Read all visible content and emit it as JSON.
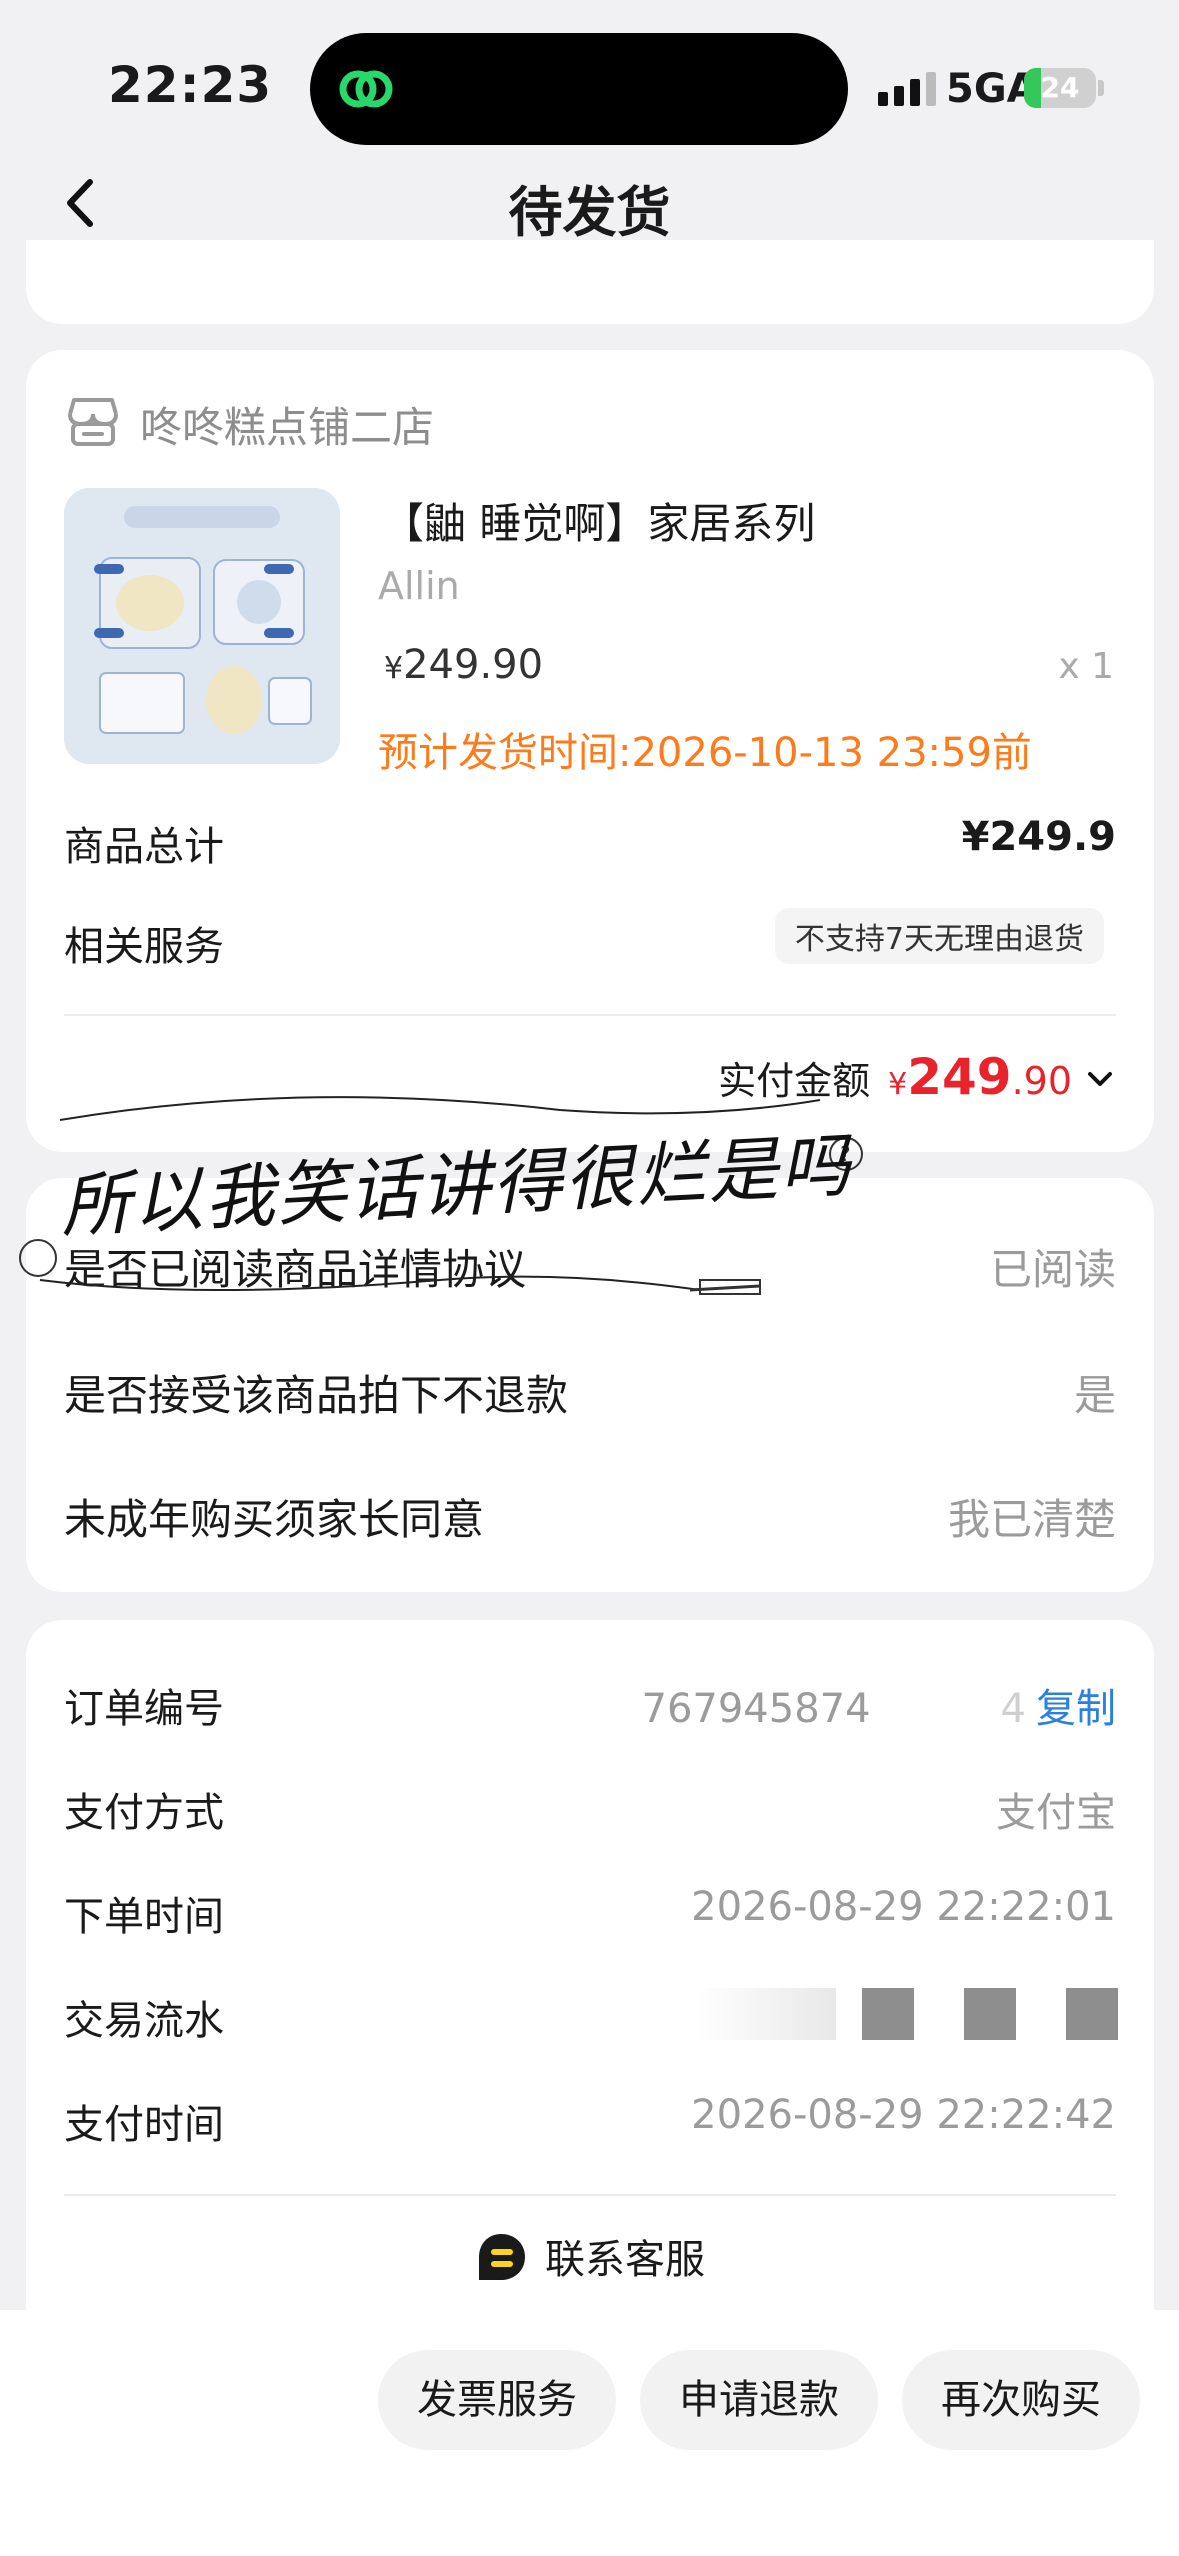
{
  "status_bar": {
    "time": "22:23",
    "network": "5GA",
    "battery": "24",
    "battery_level": 0.24
  },
  "nav": {
    "title": "待发货"
  },
  "shop": {
    "name": "咚咚糕点铺二店",
    "product_title": "【鼬 睡觉啊】家居系列",
    "product_sku": "Allin",
    "price_symbol": "¥",
    "price": "249.90",
    "quantity": "x 1",
    "ship_time": "预计发货时间:2026-10-13 23:59前",
    "total_label": "商品总计",
    "total_value": "¥249.9",
    "service_label": "相关服务",
    "service_tag": "不支持7天无理由退货",
    "paid_label": "实付金额",
    "paid_symbol": "¥",
    "paid_int": "249",
    "paid_dec": ".90"
  },
  "overlay": {
    "text": "所以我笑话讲得很烂是吗"
  },
  "agreements": [
    {
      "label": "是否已阅读商品详情协议",
      "value": "已阅读"
    },
    {
      "label": "是否接受该商品拍下不退款",
      "value": "是"
    },
    {
      "label": "未成年购买须家长同意",
      "value": "我已清楚"
    }
  ],
  "order": {
    "number_label": "订单编号",
    "number_value": "767945874",
    "number_tail": "4",
    "copy_label": "复制",
    "payment_label": "支付方式",
    "payment_value": "支付宝",
    "created_label": "下单时间",
    "created_value": "2026-08-29 22:22:01",
    "serial_label": "交易流水",
    "paid_time_label": "支付时间",
    "paid_time_value": "2026-08-29 22:22:42",
    "customer_service": "联系客服"
  },
  "actions": {
    "invoice": "发票服务",
    "refund": "申请退款",
    "rebuy": "再次购买"
  },
  "colors": {
    "accent_red": "#e8232b",
    "ship_orange": "#ff7a1a",
    "link_blue": "#2b7fe0",
    "battery_green": "#34c759"
  }
}
